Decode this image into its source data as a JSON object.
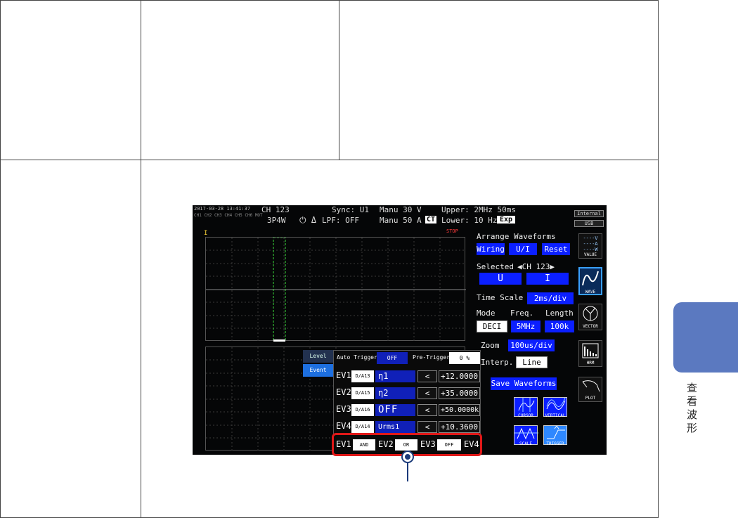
{
  "sidebar": {
    "section_label": "查看波形"
  },
  "status_bar": {
    "datetime": "2017-03-28 13:41:37",
    "channel_grid": [
      "CH1",
      "CH2",
      "CH3",
      "CH4",
      "CH5",
      "CH6",
      "MOT"
    ],
    "channel": "CH 123",
    "wiring": "3P4W",
    "sync": "Sync: U1",
    "lpf": "LPF: OFF",
    "u_range": "Manu  30 V",
    "i_range": "Manu  50 A",
    "ct_badge": "CT",
    "upper": "Upper:  2MHz  50ms",
    "lower": "Lower: 10 Hz",
    "exp_badge": "Exp",
    "stop": "STOP",
    "storage_1": "Internal",
    "storage_2": "USB",
    "cursor_marker": "I"
  },
  "right_panel": {
    "arrange_title": "Arrange Waveforms",
    "wiring": "Wiring",
    "ui": "U/I",
    "reset": "Reset",
    "selected_label": "Selected",
    "selected_value": "◀CH 123▶",
    "u_btn": "U",
    "i_btn": "I",
    "time_scale_label": "Time Scale",
    "time_scale_value": "2ms/div",
    "mode_label": "Mode",
    "freq_label": "Freq.",
    "length_label": "Length",
    "mode_value": "DECI",
    "freq_value": "5MHz",
    "length_value": "100k",
    "zoom_label": "Zoom",
    "zoom_value": "100us/div",
    "interp_label": "Interp.",
    "interp_value": "Line",
    "save_waveforms": "Save Waveforms",
    "cursor": "CURSOR",
    "vertical": "VERTICAL",
    "scale": "SCALE",
    "trigger": "TRIGGER"
  },
  "nav_icons": {
    "value": "VALUE",
    "wave": "WAVE",
    "vector": "VECTOR",
    "hrm": "HRM",
    "plot": "PLOT"
  },
  "trigger_panel": {
    "tab_level": "Level",
    "tab_event": "Event",
    "auto_trigger_label": "Auto Trigger",
    "auto_trigger_value": "OFF",
    "pre_trigger_label": "Pre-Trigger",
    "pre_trigger_value": "0 %",
    "events": [
      {
        "name": "EV1",
        "code": "D/A13",
        "sym": "η1",
        "cmp": "<",
        "val": "+12.0000"
      },
      {
        "name": "EV2",
        "code": "D/A15",
        "sym": "η2",
        "cmp": "<",
        "val": "+35.0000"
      },
      {
        "name": "EV3",
        "code": "D/A16",
        "sym": "OFF",
        "cmp": "<",
        "val": "+50.0000k"
      },
      {
        "name": "EV4",
        "code": "D/A14",
        "sym": "Urms1",
        "cmp": "<",
        "val": "+10.3600"
      }
    ],
    "combo": {
      "ev1": "EV1",
      "op1": "AND",
      "ev2": "EV2",
      "op2": "OR",
      "ev3": "EV3",
      "op3": "OFF",
      "ev4": "EV4"
    }
  },
  "colors": {
    "accent_blue": "#0b1fff",
    "callout_red": "#e01818",
    "tab_blue": "#5b79c0"
  }
}
